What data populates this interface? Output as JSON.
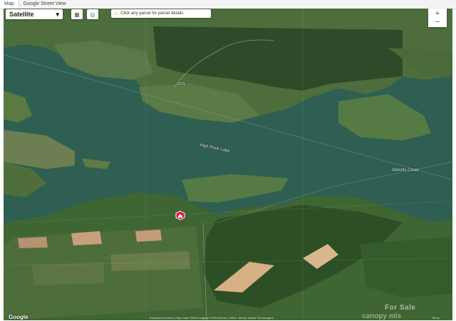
{
  "tabs": [
    "Map",
    "Google Street View"
  ],
  "maptype": {
    "label": "Satellite",
    "chevron": "chevron-down-icon"
  },
  "controls": [
    "camera-icon",
    "street-view-icon"
  ],
  "notice": {
    "icon": "warning-icon",
    "text": "Click any parcel for parcel details."
  },
  "zoom": {
    "plus": "+",
    "minus": "−"
  },
  "labels": {
    "lake": "High Rock Lake",
    "creek": "Abbotts Creek",
    "road": "1101"
  },
  "footer": {
    "logo": "Google",
    "attribution": "Keyboard shortcuts | Map data ©2024 Imagery ©2024 Airbus, CNES / Airbus, Maxar Technologies",
    "terms": "Terms"
  },
  "watermark": {
    "line1": "For Sale",
    "line2": "canopy mls"
  },
  "colors": {
    "water": "#2e5f52",
    "land": "#4a6e3a",
    "forest": "#2f4a28",
    "pin": "#d81b3c"
  }
}
